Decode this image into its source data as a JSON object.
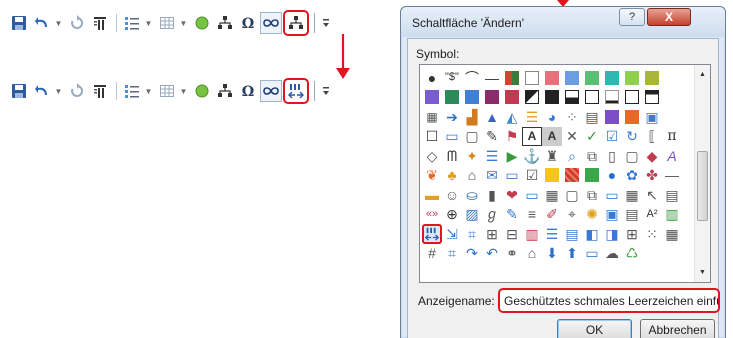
{
  "toolbar_top": {
    "icons": [
      "save-icon",
      "undo-icon",
      "redo-icon",
      "paragraph-mark-icon",
      "bulleted-list-icon",
      "table-icon",
      "circle-icon",
      "org-chart-icon",
      "omega-symbol-icon",
      "infinity-symbol-icon",
      "org-chart-icon"
    ],
    "highlighted": "org-chart-icon"
  },
  "toolbar_bottom": {
    "icons": [
      "save-icon",
      "undo-icon",
      "redo-icon",
      "paragraph-mark-icon",
      "bulleted-list-icon",
      "table-icon",
      "circle-icon",
      "org-chart-icon",
      "omega-symbol-icon",
      "infinity-symbol-icon",
      "nonbreaking-space-icon"
    ],
    "highlighted": "nonbreaking-space-icon"
  },
  "dialog": {
    "title": "Schaltfläche 'Ändern'",
    "help_label": "?",
    "close_label": "X",
    "symbol_label": "Symbol:",
    "display_name_label": "Anzeigename:",
    "display_name_value": "Geschütztes schmales Leerzeichen einfüge",
    "ok_label": "OK",
    "cancel_label": "Abbrechen",
    "selected_symbol": "nonbreaking-space-icon",
    "symbols_row1_glyphs": [
      "●",
      "\"$\"",
      "⌒",
      "—"
    ],
    "symbol_colors": [
      "#e8707a",
      "#6a9ee0",
      "#5bbf74",
      "#2fb8b0",
      "#a8b63a",
      "#7b5bd0",
      "#2a8a5a",
      "#8a2b6a",
      "#c23a50"
    ]
  },
  "accent_colors": {
    "highlight_red": "#e0161e",
    "dialog_frame": "#dfe9f5"
  }
}
